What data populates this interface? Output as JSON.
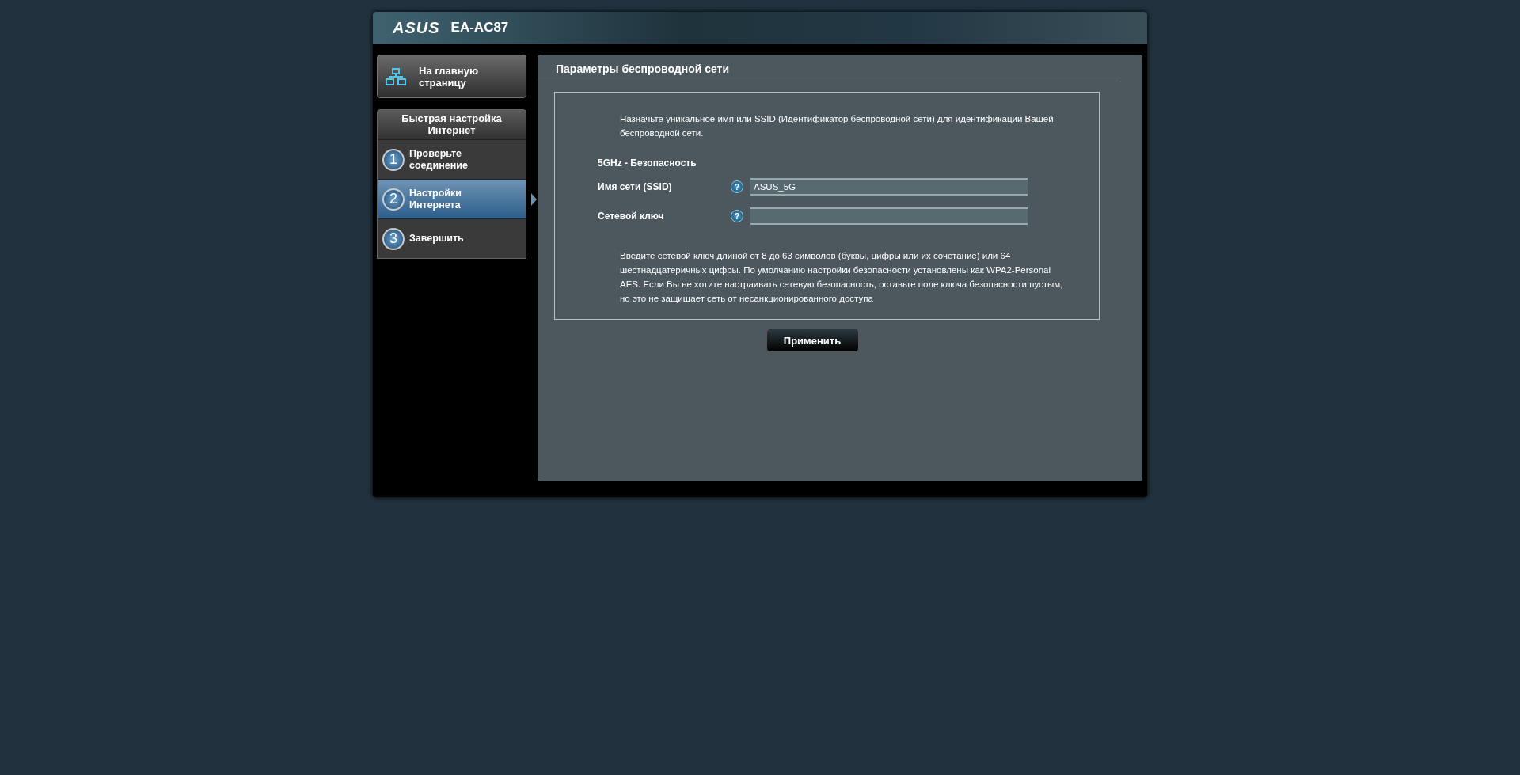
{
  "header": {
    "logo": "ASUS",
    "model": "EA-AC87"
  },
  "sidebar": {
    "home_button": "На главную страницу",
    "wizard_title": "Быстрая настройка Интернет",
    "steps": [
      {
        "number": "1",
        "label": "Проверьте соединение",
        "selected": false
      },
      {
        "number": "2",
        "label": "Настройки Интернета",
        "selected": true
      },
      {
        "number": "3",
        "label": "Завершить",
        "selected": false
      }
    ]
  },
  "panel": {
    "title": "Параметры беспроводной сети",
    "intro": "Назначьте уникальное имя или SSID (Идентификатор беспроводной сети) для идентификации Вашей беспроводной сети.",
    "section_title": "5GHz - Безопасность",
    "fields": [
      {
        "label": "Имя сети (SSID)",
        "help": "?",
        "value": "ASUS_5G"
      },
      {
        "label": "Сетевой ключ",
        "help": "?"
      }
    ],
    "note": "Введите сетевой ключ длиной от 8 до 63 символов (буквы, цифры или их сочетание) или 64 шестнадцатеричных цифры. По умолчанию настройки безопасности установлены как WPA2-Personal AES. Если Вы не хотите настраивать сетевую безопасность, оставьте поле ключа безопасности пустым, но это не защищает сеть от несанкционированного доступа",
    "apply_button": "Применить"
  }
}
